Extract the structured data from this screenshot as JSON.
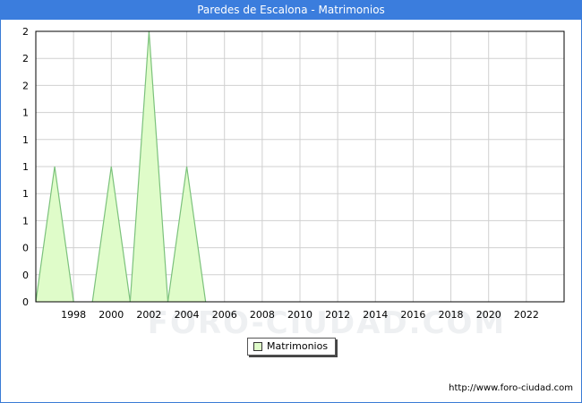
{
  "title": "Paredes de Escalona - Matrimonios",
  "watermark": "FORO-CIUDAD.COM",
  "source_url": "http://www.foro-ciudad.com",
  "colors": {
    "title_bar": "#3b7ddd",
    "area_fill": "#dffcc9",
    "area_line": "#7cc27c",
    "grid": "#d0d0d0"
  },
  "chart_data": {
    "type": "area",
    "title": "Paredes de Escalona - Matrimonios",
    "xlabel": "",
    "ylabel": "",
    "xlim": [
      1996,
      2024
    ],
    "ylim": [
      0,
      2
    ],
    "x_ticks": [
      1998,
      2000,
      2002,
      2004,
      2006,
      2008,
      2010,
      2012,
      2014,
      2016,
      2018,
      2020,
      2022
    ],
    "y_tick_values": [
      0,
      0.2,
      0.4,
      0.6,
      0.8,
      1.0,
      1.2,
      1.4,
      1.6,
      1.8,
      2.0
    ],
    "y_tick_labels": [
      "0",
      "0",
      "0",
      "1",
      "1",
      "1",
      "1",
      "1",
      "2",
      "2",
      "2"
    ],
    "grid": true,
    "legend_position": "bottom-center",
    "series": [
      {
        "name": "Matrimonios",
        "x": [
          1996,
          1997,
          1998,
          1999,
          2000,
          2001,
          2002,
          2003,
          2004,
          2005
        ],
        "values": [
          0,
          1,
          0,
          0,
          1,
          0,
          2,
          0,
          1,
          0
        ]
      }
    ]
  }
}
